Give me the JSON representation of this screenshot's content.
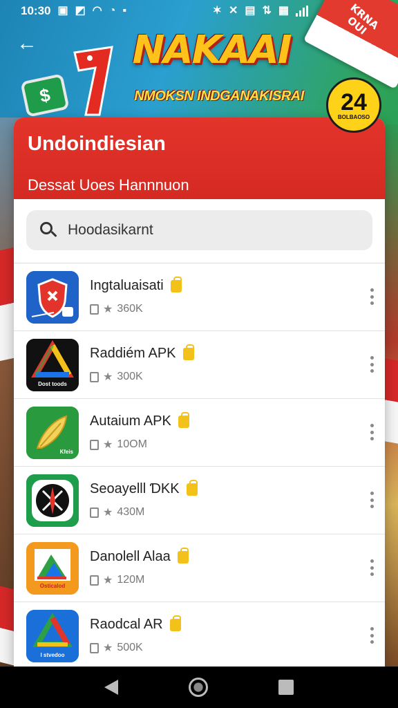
{
  "status_bar": {
    "time": "10:30"
  },
  "header": {
    "brand_title": "NAKAAI",
    "brand_subtitle": "NMOKSN INDGANAKISRAI",
    "badge_number": "24",
    "badge_caption": "BOLBAOSO",
    "corner_flag_text": "KRNA OUI"
  },
  "money_icon_text": "$",
  "card": {
    "title": "Undoindiesian",
    "subtitle": "Dessat Uoes Hannnuon"
  },
  "search": {
    "value": "Hoodasikarnt"
  },
  "apps": [
    {
      "name": "Ingtaluaisati",
      "size": "360K",
      "icon": "shield-icon",
      "icon_caption": "",
      "color": "#1a73e8"
    },
    {
      "name": "Raddiém APK",
      "size": "300K",
      "icon": "prism-icon",
      "icon_caption": "Dost toods",
      "color": "#111111"
    },
    {
      "name": "Autaium APK",
      "size": "10ОМ",
      "icon": "leaf-icon",
      "icon_caption": "Kfeis",
      "color": "#2ea043"
    },
    {
      "name": "Seoayelll ƊKK",
      "size": "430M",
      "icon": "compass-icon",
      "icon_caption": "",
      "color": "#1e9e4a"
    },
    {
      "name": "Danolell Alaa",
      "size": "120M",
      "icon": "map-icon",
      "icon_caption": "Osticalod",
      "color": "#f39a1e"
    },
    {
      "name": "Raodcal AR",
      "size": "500K",
      "icon": "drive-icon",
      "icon_caption": "I stvedoo",
      "color": "#1a73e8"
    }
  ]
}
